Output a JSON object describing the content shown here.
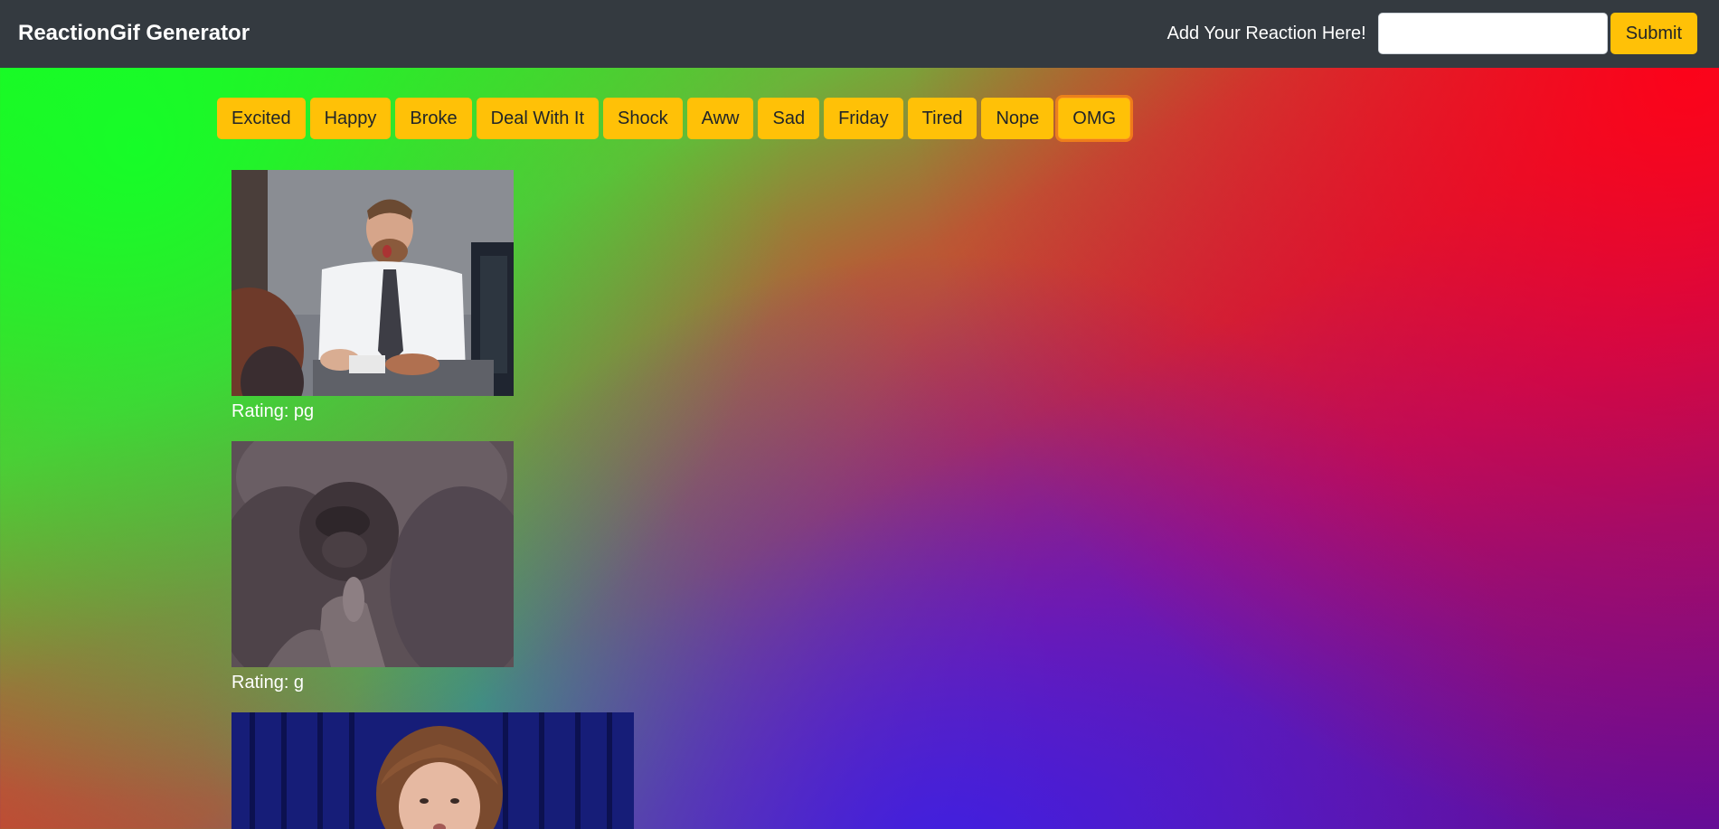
{
  "navbar": {
    "brand": "ReactionGif Generator",
    "prompt_label": "Add Your Reaction Here!",
    "input_value": "",
    "input_placeholder": "",
    "submit_label": "Submit"
  },
  "reactions": [
    {
      "label": "Excited"
    },
    {
      "label": "Happy"
    },
    {
      "label": "Broke"
    },
    {
      "label": "Deal With It"
    },
    {
      "label": "Shock"
    },
    {
      "label": "Aww"
    },
    {
      "label": "Sad"
    },
    {
      "label": "Friday"
    },
    {
      "label": "Tired"
    },
    {
      "label": "Nope"
    },
    {
      "label": "OMG",
      "active": true
    }
  ],
  "gifs": [
    {
      "subject": "office meeting reaction",
      "rating_text": "Rating: pg"
    },
    {
      "subject": "gorilla reaction",
      "rating_text": "Rating: g"
    },
    {
      "subject": "woman in front of blue curtain",
      "rating_text": ""
    }
  ],
  "colors": {
    "navbar_bg": "#343a40",
    "button_bg": "#ffc107",
    "button_text": "#212529",
    "active_ring": "#ff8c14"
  }
}
